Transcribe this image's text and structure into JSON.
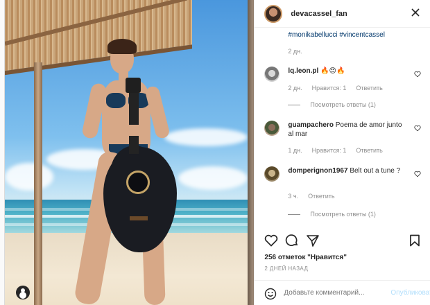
{
  "header": {
    "username": "devacassel_fan",
    "close_icon": "close-icon"
  },
  "caption": {
    "tags": "#monikabellucci #vincentcassel",
    "time": "2 дн."
  },
  "comments": [
    {
      "user": "lq.leon.pl",
      "text": "🔥😍🔥",
      "time": "2 дн.",
      "likes": "Нравится: 1",
      "reply": "Ответить",
      "replies": "Посмотреть ответы (1)"
    },
    {
      "user": "guampachero",
      "text": "Poema de amor junto al mar",
      "time": "1 дн.",
      "likes": "Нравится: 1",
      "reply": "Ответить"
    },
    {
      "user": "domperignon1967",
      "text": "Belt out a tune ?",
      "time": "3 ч.",
      "reply": "Ответить",
      "replies": "Посмотреть ответы (1)"
    }
  ],
  "post": {
    "likes": "256 отметок \"Нравится\"",
    "date": "2 ДНЕЙ НАЗАД",
    "add_comment_placeholder": "Добавьте комментарий...",
    "publish_label": "Опубликовать"
  },
  "colors": {
    "link": "#00376b",
    "publish": "#b2dffc",
    "meta": "#8e8e8e"
  }
}
